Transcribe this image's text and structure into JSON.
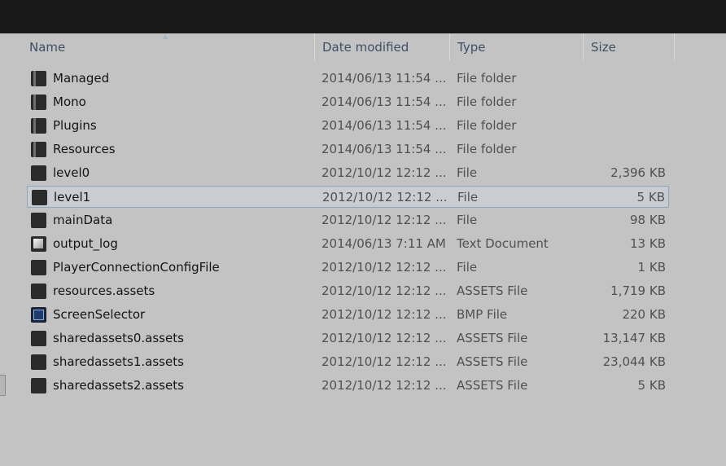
{
  "columns": {
    "name": "Name",
    "date": "Date modified",
    "type": "Type",
    "size": "Size"
  },
  "files": [
    {
      "name": "Managed",
      "date": "2014/06/13 11:54 ...",
      "type": "File folder",
      "size": "",
      "icon": "folder-icon"
    },
    {
      "name": "Mono",
      "date": "2014/06/13 11:54 ...",
      "type": "File folder",
      "size": "",
      "icon": "folder-icon"
    },
    {
      "name": "Plugins",
      "date": "2014/06/13 11:54 ...",
      "type": "File folder",
      "size": "",
      "icon": "folder-icon"
    },
    {
      "name": "Resources",
      "date": "2014/06/13 11:54 ...",
      "type": "File folder",
      "size": "",
      "icon": "folder-icon"
    },
    {
      "name": "level0",
      "date": "2012/10/12 12:12 ...",
      "type": "File",
      "size": "2,396 KB",
      "icon": "file-icon"
    },
    {
      "name": "level1",
      "date": "2012/10/12 12:12 ...",
      "type": "File",
      "size": "5 KB",
      "icon": "file-icon",
      "selected": true
    },
    {
      "name": "mainData",
      "date": "2012/10/12 12:12 ...",
      "type": "File",
      "size": "98 KB",
      "icon": "file-icon"
    },
    {
      "name": "output_log",
      "date": "2014/06/13 7:11 AM",
      "type": "Text Document",
      "size": "13 KB",
      "icon": "text-document-icon"
    },
    {
      "name": "PlayerConnectionConfigFile",
      "date": "2012/10/12 12:12 ...",
      "type": "File",
      "size": "1 KB",
      "icon": "file-icon"
    },
    {
      "name": "resources.assets",
      "date": "2012/10/12 12:12 ...",
      "type": "ASSETS File",
      "size": "1,719 KB",
      "icon": "file-icon"
    },
    {
      "name": "ScreenSelector",
      "date": "2012/10/12 12:12 ...",
      "type": "BMP File",
      "size": "220 KB",
      "icon": "bmp-image-icon"
    },
    {
      "name": "sharedassets0.assets",
      "date": "2012/10/12 12:12 ...",
      "type": "ASSETS File",
      "size": "13,147 KB",
      "icon": "file-icon"
    },
    {
      "name": "sharedassets1.assets",
      "date": "2012/10/12 12:12 ...",
      "type": "ASSETS File",
      "size": "23,044 KB",
      "icon": "file-icon"
    },
    {
      "name": "sharedassets2.assets",
      "date": "2012/10/12 12:12 ...",
      "type": "ASSETS File",
      "size": "5 KB",
      "icon": "file-icon"
    }
  ],
  "colors": {
    "background": "#c3c3c3",
    "titlebar": "#181818",
    "header_text": "#3f4f64",
    "selection_border": "#8ea4be"
  }
}
